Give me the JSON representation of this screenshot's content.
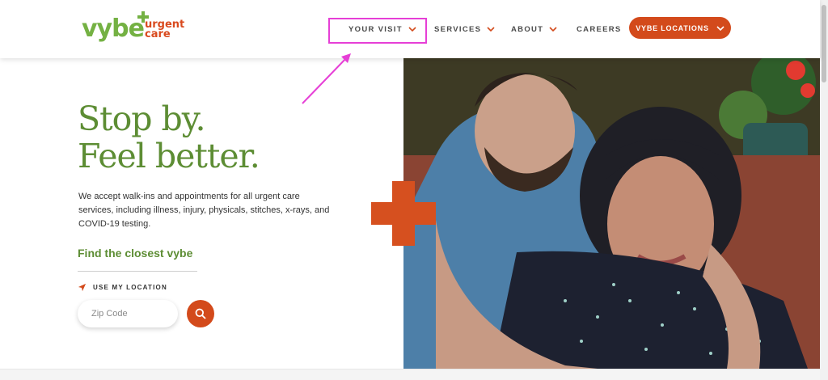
{
  "brand": {
    "name": "vybe",
    "subtitle_line1": "urgent",
    "subtitle_line2": "care",
    "green": "#74b143",
    "orange": "#d34a1b"
  },
  "nav": {
    "your_visit": "YOUR VISIT",
    "services": "SERVICES",
    "about": "ABOUT",
    "careers": "CAREERS",
    "locations_button": "VYBE LOCATIONS"
  },
  "hero": {
    "title_line1": "Stop by.",
    "title_line2": "Feel better.",
    "description": "We accept walk-ins and appointments for all urgent care services, including illness, injury, physicals, stitches, x-rays, and COVID-19 testing.",
    "find_title": "Find the closest vybe",
    "use_location": "USE MY LOCATION",
    "zip_placeholder": "Zip Code",
    "zip_value": ""
  },
  "annotation": {
    "highlight_color": "#e63fd6"
  },
  "icons": {
    "logo_plus": "plus-icon",
    "nav_chevron": "chevron-down-icon",
    "location": "location-arrow-icon",
    "search": "search-icon",
    "big_plus": "plus-icon"
  }
}
